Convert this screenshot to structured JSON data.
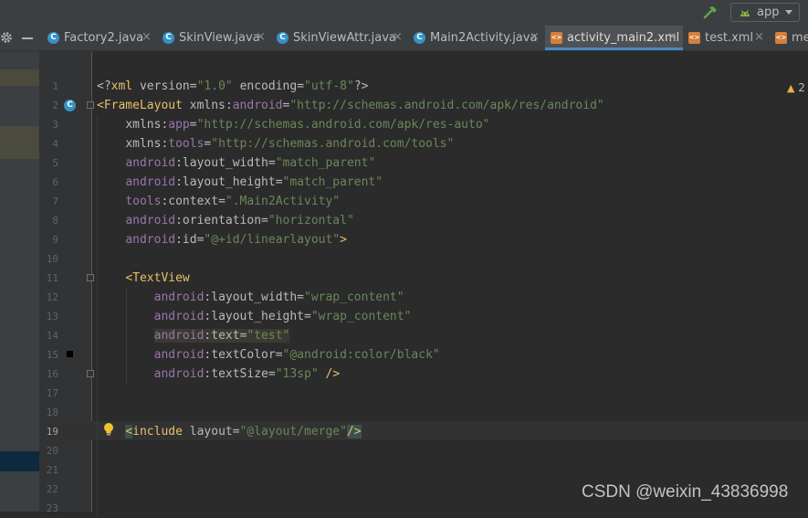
{
  "toolbar": {
    "run_config_label": "app"
  },
  "tabs": [
    {
      "name": "Factory2.java",
      "icon": "class-icon"
    },
    {
      "name": "SkinView.java",
      "icon": "class-icon"
    },
    {
      "name": "SkinViewAttr.java",
      "icon": "class-icon"
    },
    {
      "name": "Main2Activity.java",
      "icon": "class-icon"
    },
    {
      "name": "activity_main2.xml",
      "icon": "xml-file-icon",
      "active": true
    },
    {
      "name": "test.xml",
      "icon": "xml-file-icon"
    },
    {
      "name": "me",
      "icon": "xml-file-icon"
    }
  ],
  "editor": {
    "line_numbers": [
      "1",
      "2",
      "3",
      "4",
      "5",
      "6",
      "7",
      "8",
      "9",
      "10",
      "11",
      "12",
      "13",
      "14",
      "15",
      "16",
      "17",
      "18",
      "19",
      "20",
      "21",
      "22",
      "23"
    ],
    "current_line": "19",
    "warning_count": "2",
    "lines": [
      [
        [
          "punc",
          "<?"
        ],
        [
          "tag",
          "xml "
        ],
        [
          "attr",
          "version"
        ],
        [
          "punc",
          "="
        ],
        [
          "str",
          "\"1.0\""
        ],
        [
          "punc",
          " "
        ],
        [
          "attr",
          "encoding"
        ],
        [
          "punc",
          "="
        ],
        [
          "str",
          "\"utf-8\""
        ],
        [
          "punc",
          "?>"
        ]
      ],
      [
        [
          "tag",
          "<FrameLayout "
        ],
        [
          "attr",
          "xmlns:"
        ],
        [
          "ns",
          "android"
        ],
        [
          "punc",
          "="
        ],
        [
          "str",
          "\"http://schemas.android.com/apk/res/android\""
        ]
      ],
      [
        [
          "punc",
          "    "
        ],
        [
          "attr",
          "xmlns:"
        ],
        [
          "ns",
          "app"
        ],
        [
          "punc",
          "="
        ],
        [
          "str",
          "\"http://schemas.android.com/apk/res-auto\""
        ]
      ],
      [
        [
          "punc",
          "    "
        ],
        [
          "attr",
          "xmlns:"
        ],
        [
          "ns",
          "tools"
        ],
        [
          "punc",
          "="
        ],
        [
          "str",
          "\"http://schemas.android.com/tools\""
        ]
      ],
      [
        [
          "punc",
          "    "
        ],
        [
          "ns",
          "android"
        ],
        [
          "attr",
          ":layout_width"
        ],
        [
          "punc",
          "="
        ],
        [
          "str",
          "\"match_parent\""
        ]
      ],
      [
        [
          "punc",
          "    "
        ],
        [
          "ns",
          "android"
        ],
        [
          "attr",
          ":layout_height"
        ],
        [
          "punc",
          "="
        ],
        [
          "str",
          "\"match_parent\""
        ]
      ],
      [
        [
          "punc",
          "    "
        ],
        [
          "ns",
          "tools"
        ],
        [
          "attr",
          ":context"
        ],
        [
          "punc",
          "="
        ],
        [
          "str",
          "\".Main2Activity\""
        ]
      ],
      [
        [
          "punc",
          "    "
        ],
        [
          "ns",
          "android"
        ],
        [
          "attr",
          ":orientation"
        ],
        [
          "punc",
          "="
        ],
        [
          "str",
          "\"horizontal\""
        ]
      ],
      [
        [
          "punc",
          "    "
        ],
        [
          "ns",
          "android"
        ],
        [
          "attr",
          ":id"
        ],
        [
          "punc",
          "="
        ],
        [
          "str",
          "\"@+id/linearlayout\""
        ],
        [
          "tag",
          ">"
        ]
      ],
      [],
      [
        [
          "punc",
          "    "
        ],
        [
          "tag",
          "<TextView"
        ]
      ],
      [
        [
          "punc",
          "        "
        ],
        [
          "ns",
          "android"
        ],
        [
          "attr",
          ":layout_width"
        ],
        [
          "punc",
          "="
        ],
        [
          "str",
          "\"wrap_content\""
        ]
      ],
      [
        [
          "punc",
          "        "
        ],
        [
          "ns",
          "android"
        ],
        [
          "attr",
          ":layout_height"
        ],
        [
          "punc",
          "="
        ],
        [
          "str",
          "\"wrap_content\""
        ]
      ],
      [
        [
          "punc",
          "        "
        ],
        [
          "ns hl",
          "android"
        ],
        [
          "attr hl",
          ":text"
        ],
        [
          "punc hl",
          "="
        ],
        [
          "str hl",
          "\"test\""
        ]
      ],
      [
        [
          "punc",
          "        "
        ],
        [
          "ns",
          "android"
        ],
        [
          "attr",
          ":textColor"
        ],
        [
          "punc",
          "="
        ],
        [
          "str",
          "\"@android:color/black\""
        ]
      ],
      [
        [
          "punc",
          "        "
        ],
        [
          "ns",
          "android"
        ],
        [
          "attr",
          ":textSize"
        ],
        [
          "punc",
          "="
        ],
        [
          "str",
          "\"13sp\""
        ],
        [
          "punc",
          " "
        ],
        [
          "tag",
          "/>"
        ]
      ],
      [],
      [],
      [
        [
          "punc",
          "    "
        ],
        [
          "tag brace-hl",
          "<"
        ],
        [
          "tag",
          "include "
        ],
        [
          "attr",
          "layout"
        ],
        [
          "punc",
          "="
        ],
        [
          "str",
          "\"@layout/merge\""
        ],
        [
          "tag brace-hl",
          "/>"
        ]
      ],
      [],
      [],
      [],
      []
    ]
  },
  "watermark": "CSDN @weixin_43836998"
}
